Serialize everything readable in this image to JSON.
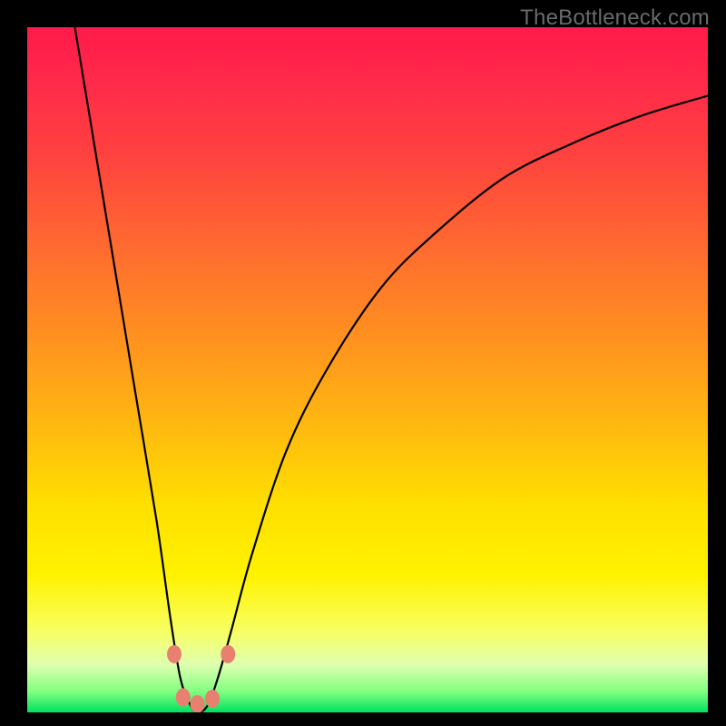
{
  "watermark": "TheBottleneck.com",
  "chart_data": {
    "type": "line",
    "title": "",
    "xlabel": "",
    "ylabel": "",
    "series": [
      {
        "name": "curve",
        "x": [
          0.07,
          0.1,
          0.13,
          0.16,
          0.19,
          0.21,
          0.225,
          0.24,
          0.25,
          0.265,
          0.28,
          0.3,
          0.33,
          0.38,
          0.44,
          0.52,
          0.6,
          0.7,
          0.8,
          0.9,
          1.0
        ],
        "y": [
          1.0,
          0.82,
          0.64,
          0.46,
          0.28,
          0.14,
          0.05,
          0.01,
          0.0,
          0.01,
          0.05,
          0.12,
          0.23,
          0.38,
          0.5,
          0.62,
          0.7,
          0.78,
          0.83,
          0.87,
          0.9
        ]
      }
    ],
    "markers": {
      "name": "dots",
      "points": [
        {
          "x": 0.216,
          "y": 0.085
        },
        {
          "x": 0.295,
          "y": 0.085
        },
        {
          "x": 0.229,
          "y": 0.022
        },
        {
          "x": 0.25,
          "y": 0.012
        },
        {
          "x": 0.272,
          "y": 0.02
        }
      ],
      "color": "#e88070",
      "rx": 8,
      "ry": 10
    },
    "xlim": [
      0,
      1
    ],
    "ylim": [
      0,
      1
    ]
  }
}
